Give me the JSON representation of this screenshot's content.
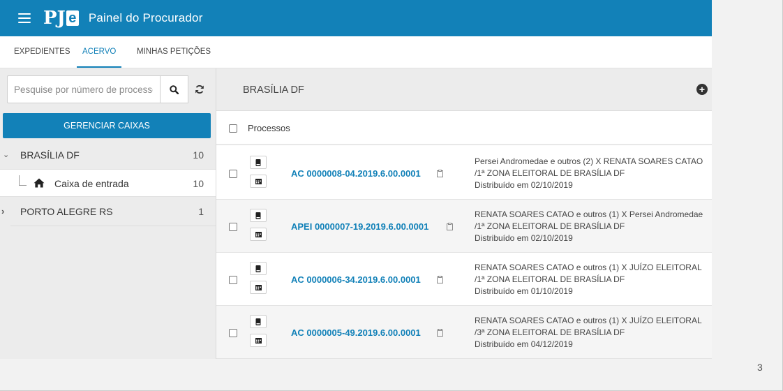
{
  "header": {
    "logo_text": "PJ",
    "logo_accent": "e",
    "title": "Painel do Procurador"
  },
  "tabs": [
    {
      "label": "EXPEDIENTES"
    },
    {
      "label": "ACERVO"
    },
    {
      "label": "MINHAS PETIÇÕES"
    }
  ],
  "sidebar": {
    "search_placeholder": "Pesquise por número de processo",
    "manage_button": "GERENCIAR CAIXAS",
    "tree": [
      {
        "label": "BRASÍLIA DF",
        "count": "10"
      },
      {
        "label": "Caixa de entrada",
        "count": "10"
      },
      {
        "label": "PORTO ALEGRE RS",
        "count": "1"
      }
    ]
  },
  "main": {
    "title": "BRASÍLIA DF",
    "list_header": "Processos",
    "rows": [
      {
        "id": "AC 0000008-04.2019.6.00.0001",
        "parties": "Persei Andromedae e outros (2) X RENATA SOARES CATAO",
        "court": "/1ª ZONA ELEITORAL DE BRASÍLIA DF",
        "date": "Distribuído em 02/10/2019"
      },
      {
        "id": "APEI 0000007-19.2019.6.00.0001",
        "parties": "RENATA SOARES CATAO e outros (1) X Persei Andromedae",
        "court": "/1ª ZONA ELEITORAL DE BRASÍLIA DF",
        "date": "Distribuído em 02/10/2019"
      },
      {
        "id": "AC 0000006-34.2019.6.00.0001",
        "parties": "RENATA SOARES CATAO e outros (1) X JUÍZO ELEITORAL",
        "court": "/1ª ZONA ELEITORAL DE BRASÍLIA DF",
        "date": "Distribuído em 01/10/2019"
      },
      {
        "id": "AC 0000005-49.2019.6.00.0001",
        "parties": "RENATA SOARES CATAO e outros (1) X JUÍZO ELEITORAL",
        "court": "/3ª ZONA ELEITORAL DE BRASÍLIA DF",
        "date": "Distribuído em 04/12/2019"
      }
    ]
  },
  "page_number": "3",
  "colors": {
    "primary": "#1281b8",
    "sidebar_bg": "#ececec"
  }
}
